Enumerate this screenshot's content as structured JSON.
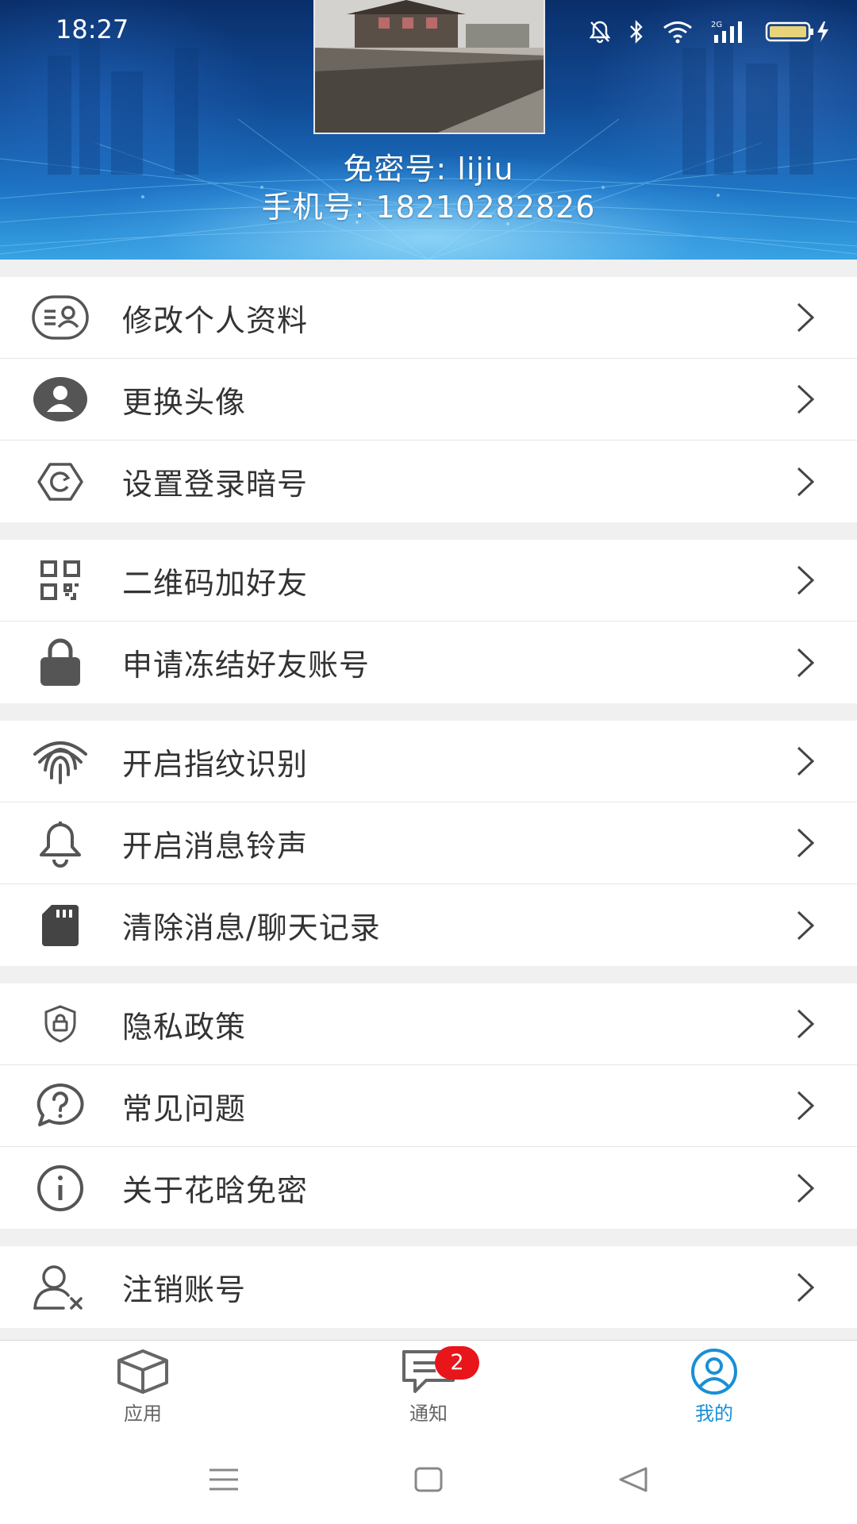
{
  "status_bar": {
    "time": "18:27",
    "icons": [
      "mute-bell-icon",
      "bluetooth-icon",
      "wifi-icon",
      "signal-2g-icon",
      "battery-charging-icon"
    ]
  },
  "profile": {
    "id_line": "免密号: lijiu",
    "phone_line": "手机号: 18210282826"
  },
  "menu": {
    "groups": [
      [
        {
          "label": "修改个人资料",
          "icon": "profile-card-icon"
        },
        {
          "label": "更换头像",
          "icon": "avatar-icon"
        },
        {
          "label": "设置登录暗号",
          "icon": "gear-icon"
        }
      ],
      [
        {
          "label": "二维码加好友",
          "icon": "qr-code-icon"
        },
        {
          "label": "申请冻结好友账号",
          "icon": "lock-icon"
        }
      ],
      [
        {
          "label": "开启指纹识别",
          "icon": "fingerprint-icon"
        },
        {
          "label": "开启消息铃声",
          "icon": "bell-icon"
        },
        {
          "label": "清除消息/聊天记录",
          "icon": "sd-card-icon"
        }
      ],
      [
        {
          "label": "隐私政策",
          "icon": "shield-icon"
        },
        {
          "label": "常见问题",
          "icon": "help-bubble-icon"
        },
        {
          "label": "关于花晗免密",
          "icon": "info-icon"
        }
      ],
      [
        {
          "label": "注销账号",
          "icon": "user-remove-icon"
        }
      ]
    ]
  },
  "tabs": [
    {
      "label": "应用",
      "icon": "cube-icon"
    },
    {
      "label": "通知",
      "icon": "chat-icon",
      "badge": "2"
    },
    {
      "label": "我的",
      "icon": "user-circle-icon",
      "active": true
    }
  ],
  "colors": {
    "accent": "#1a8fd6",
    "badge": "#e8151a",
    "icon": "#555555",
    "text": "#333333"
  }
}
